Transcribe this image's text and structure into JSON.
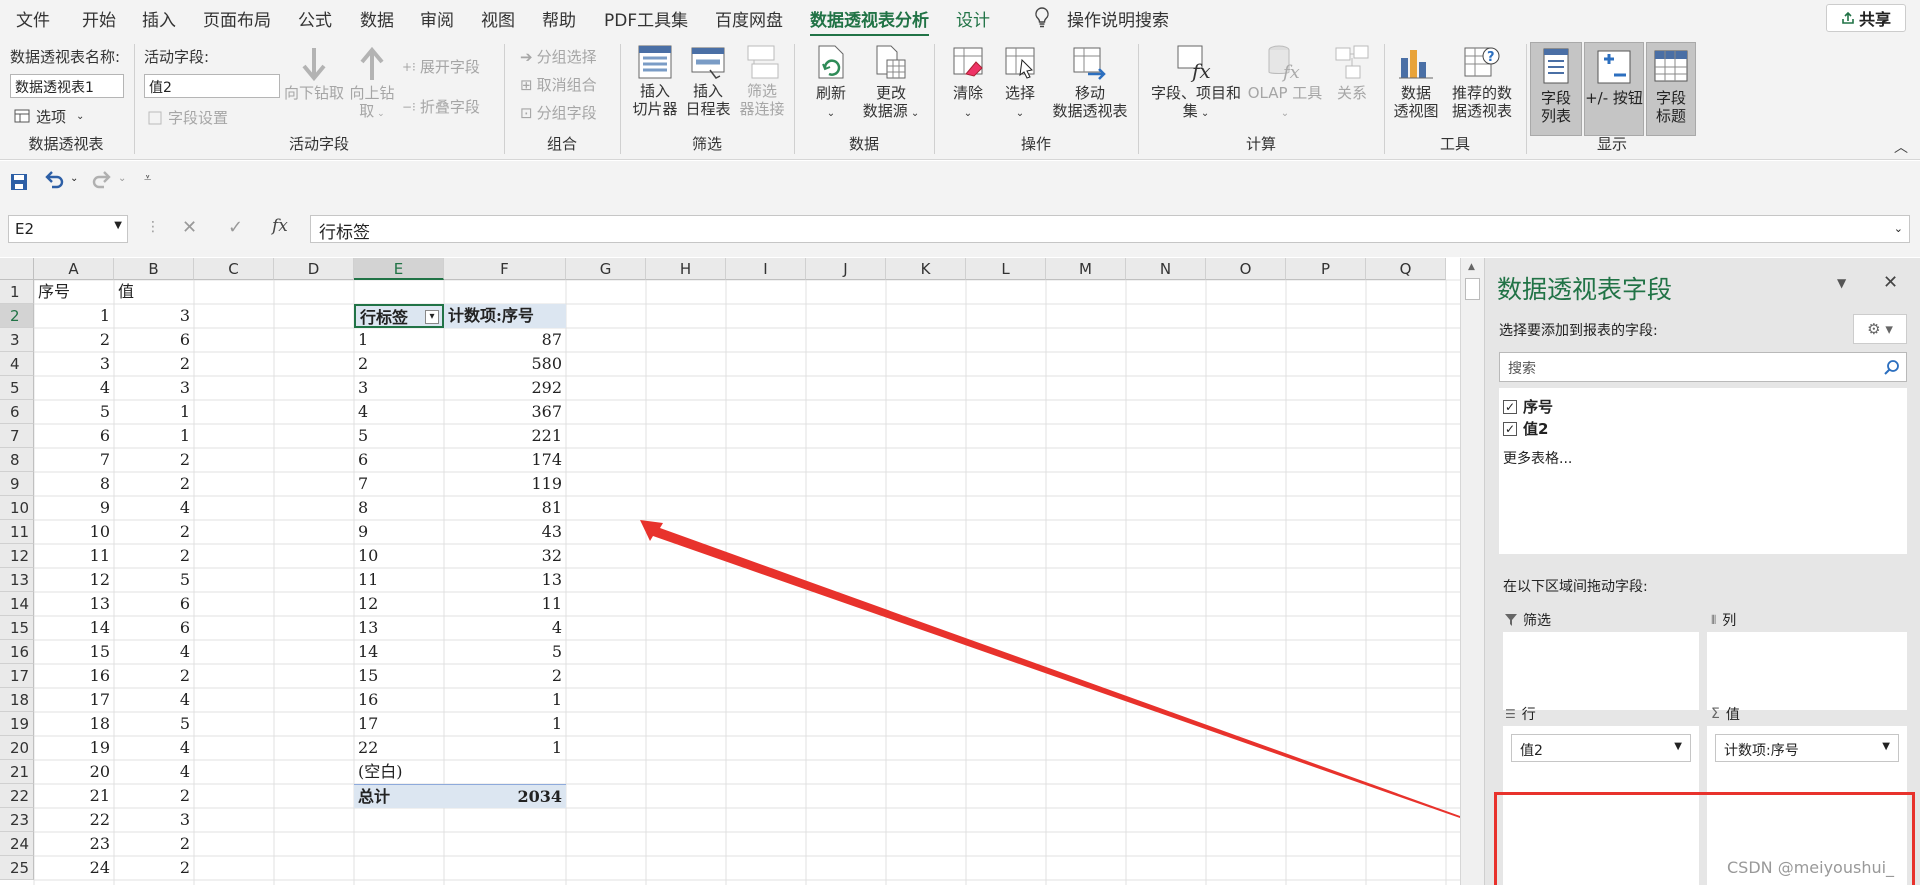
{
  "tabs": [
    "文件",
    "开始",
    "插入",
    "页面布局",
    "公式",
    "数据",
    "审阅",
    "视图",
    "帮助",
    "PDF工具集",
    "百度网盘",
    "数据透视表分析",
    "设计"
  ],
  "tellme": "操作说明搜索",
  "share": "共享",
  "ribbon": {
    "pt_name_label": "数据透视表名称:",
    "pt_name_value": "数据透视表1",
    "options": "选项",
    "grp_pivot": "数据透视表",
    "active_field_label": "活动字段:",
    "active_field_value": "值2",
    "field_settings": "字段设置",
    "drill_down": "向下钻取",
    "drill_up": "向上钻",
    "drill_up2": "取",
    "expand_field": "展开字段",
    "collapse_field": "折叠字段",
    "grp_active": "活动字段",
    "group_selection": "分组选择",
    "ungroup": "取消组合",
    "group_field": "分组字段",
    "grp_group": "组合",
    "insert_slicer": "插入",
    "insert_slicer2": "切片器",
    "insert_timeline": "插入",
    "insert_timeline2": "日程表",
    "filter_conn": "筛选",
    "filter_conn2": "器连接",
    "grp_filter": "筛选",
    "refresh": "刷新",
    "change_source": "更改",
    "change_source2": "数据源",
    "grp_data": "数据",
    "clear": "清除",
    "select": "选择",
    "move": "移动",
    "move2": "数据透视表",
    "grp_action": "操作",
    "fields_items": "字段、项目和",
    "fields_items2": "集",
    "olap": "OLAP 工具",
    "relations": "关系",
    "grp_calc": "计算",
    "pivotchart": "数据",
    "pivotchart2": "透视图",
    "recommended": "推荐的数",
    "recommended2": "据透视表",
    "grp_tools": "工具",
    "field_list": "字段",
    "field_list2": "列表",
    "buttons": "+/- 按钮",
    "headers": "字段",
    "headers2": "标题",
    "grp_show": "显示"
  },
  "formula": {
    "namebox": "E2",
    "fx": "fx",
    "content": "行标签"
  },
  "columns": [
    "A",
    "B",
    "C",
    "D",
    "E",
    "F",
    "G",
    "H",
    "I",
    "J",
    "K",
    "L",
    "M",
    "N",
    "O",
    "P",
    "Q"
  ],
  "rows": [
    "1",
    "2",
    "3",
    "4",
    "5",
    "6",
    "7",
    "8",
    "9",
    "10",
    "11",
    "12",
    "13",
    "14",
    "15",
    "16",
    "17",
    "18",
    "19",
    "20",
    "21",
    "22",
    "23",
    "24",
    "25"
  ],
  "colA": [
    "序号",
    "1",
    "2",
    "3",
    "4",
    "5",
    "6",
    "7",
    "8",
    "9",
    "10",
    "11",
    "12",
    "13",
    "14",
    "15",
    "16",
    "17",
    "18",
    "19",
    "20",
    "21",
    "22",
    "23",
    "24"
  ],
  "colB": [
    "值",
    "3",
    "6",
    "2",
    "3",
    "1",
    "1",
    "2",
    "2",
    "4",
    "2",
    "2",
    "5",
    "6",
    "6",
    "4",
    "2",
    "4",
    "5",
    "4",
    "4",
    "2",
    "3",
    "2",
    "2"
  ],
  "pivot": {
    "hdr_row": "行标签",
    "hdr_val": "计数项:序号",
    "labels": [
      "1",
      "2",
      "3",
      "4",
      "5",
      "6",
      "7",
      "8",
      "9",
      "10",
      "11",
      "12",
      "13",
      "14",
      "15",
      "16",
      "17",
      "22",
      "(空白)"
    ],
    "values": [
      "87",
      "580",
      "292",
      "367",
      "221",
      "174",
      "119",
      "81",
      "43",
      "32",
      "13",
      "11",
      "4",
      "5",
      "2",
      "1",
      "1",
      "1",
      ""
    ],
    "total_label": "总计",
    "total_value": "2034"
  },
  "pane": {
    "title": "数据透视表字段",
    "subtitle": "选择要添加到报表的字段:",
    "search_placeholder": "搜索",
    "fields": [
      "序号",
      "值2"
    ],
    "more_tables": "更多表格...",
    "drag_label": "在以下区域间拖动字段:",
    "filter": "筛选",
    "columns": "列",
    "rows": "行",
    "values": "值",
    "row_item": "值2",
    "value_item": "计数项:序号"
  },
  "watermark": "CSDN @meiyoushui_",
  "colors": {
    "excel_green": "#217346",
    "annotation_red": "#e8322c"
  }
}
